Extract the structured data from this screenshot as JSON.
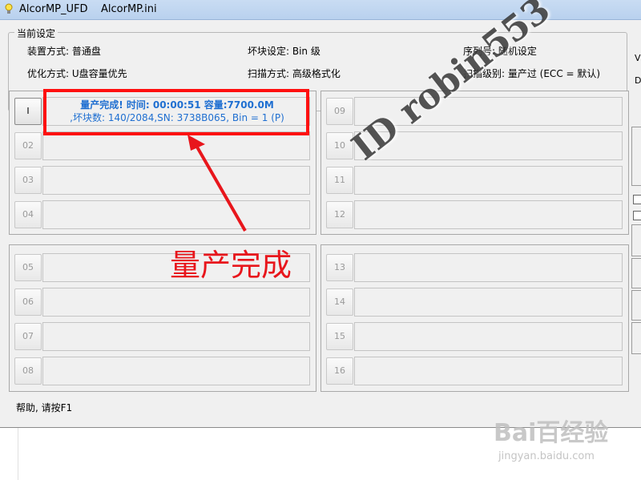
{
  "window": {
    "title_app": "AlcorMP_UFD",
    "title_file": "AlcorMP.ini"
  },
  "settings": {
    "group_title": "当前设定",
    "install_mode": "装置方式: 普通盘",
    "bad_block": "坏块设定: Bin 级",
    "serial": "序列号: 随机设定",
    "optimize": "优化方式: U盘容量优先",
    "scan_mode": "扫描方式: 高级格式化",
    "scan_level": "扫描级别: 量产过 (ECC = 默认)"
  },
  "ports": {
    "group1": [
      {
        "label": "I",
        "active": true
      },
      {
        "label": "02",
        "active": false
      },
      {
        "label": "03",
        "active": false
      },
      {
        "label": "04",
        "active": false
      }
    ],
    "group2": [
      {
        "label": "09",
        "active": false
      },
      {
        "label": "10",
        "active": false
      },
      {
        "label": "11",
        "active": false
      },
      {
        "label": "12",
        "active": false
      }
    ],
    "group3": [
      {
        "label": "05",
        "active": false
      },
      {
        "label": "06",
        "active": false
      },
      {
        "label": "07",
        "active": false
      },
      {
        "label": "08",
        "active": false
      }
    ],
    "group4": [
      {
        "label": "13",
        "active": false
      },
      {
        "label": "14",
        "active": false
      },
      {
        "label": "15",
        "active": false
      },
      {
        "label": "16",
        "active": false
      }
    ]
  },
  "status": {
    "line1": "量产完成! 时间: 00:00:51 容量:7700.0M",
    "line2": ",坏块数: 140/2084,SN: 3738B065, Bin = 1 (P)"
  },
  "annotation": {
    "text": "量产完成",
    "watermark": "ID robin553",
    "color": "#ff1010"
  },
  "help": "帮助, 请按F1",
  "edge": {
    "letter_v": "V",
    "letter_d": "D"
  },
  "baidu": {
    "logo": "Bai百经验",
    "url": "jingyan.baidu.com"
  }
}
